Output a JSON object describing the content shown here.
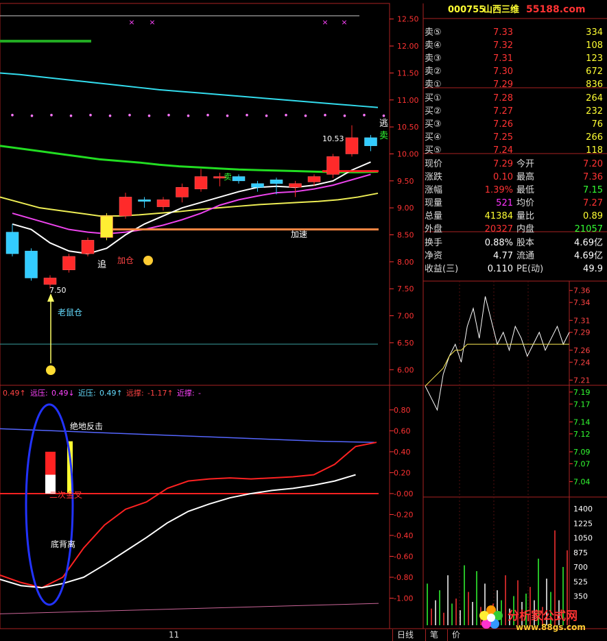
{
  "colors": {
    "up": "#ff2a2a",
    "down": "#33ccff",
    "grid": "#aa2222",
    "axis": "#ff3333",
    "bg": "#000000"
  },
  "header": {
    "code": "000755",
    "name": "山西三维",
    "watermark_top": "55188.com"
  },
  "quote": {
    "sell": [
      {
        "label": "卖⑤",
        "price": "7.33",
        "vol": "334"
      },
      {
        "label": "卖④",
        "price": "7.32",
        "vol": "108"
      },
      {
        "label": "卖③",
        "price": "7.31",
        "vol": "123"
      },
      {
        "label": "卖②",
        "price": "7.30",
        "vol": "672"
      },
      {
        "label": "卖①",
        "price": "7.29",
        "vol": "836"
      }
    ],
    "buy": [
      {
        "label": "买①",
        "price": "7.28",
        "vol": "264"
      },
      {
        "label": "买②",
        "price": "7.27",
        "vol": "232"
      },
      {
        "label": "买③",
        "price": "7.26",
        "vol": "76"
      },
      {
        "label": "买④",
        "price": "7.25",
        "vol": "266"
      },
      {
        "label": "买⑤",
        "price": "7.24",
        "vol": "118"
      }
    ],
    "stats": [
      {
        "l1": "现价",
        "v1": "7.29",
        "l2": "今开",
        "v2": "7.20"
      },
      {
        "l1": "涨跌",
        "v1": "0.10",
        "l2": "最高",
        "v2": "7.36"
      },
      {
        "l1": "涨幅",
        "v1": "1.39%",
        "l2": "最低",
        "v2": "7.15"
      },
      {
        "l1": "现量",
        "v1": "521",
        "l2": "均价",
        "v2": "7.27"
      },
      {
        "l1": "总量",
        "v1": "41384",
        "l2": "量比",
        "v2": "0.89"
      },
      {
        "l1": "外盘",
        "v1": "20327",
        "l2": "内盘",
        "v2": "21057"
      }
    ],
    "fund": [
      {
        "l1": "换手",
        "v1": "0.88%",
        "l2": "股本",
        "v2": "4.69亿"
      },
      {
        "l1": "净资",
        "v1": "4.77",
        "l2": "流通",
        "v2": "4.69亿"
      },
      {
        "l1": "收益(三)",
        "v1": "0.110",
        "l2": "PE(动)",
        "v2": "49.9"
      }
    ]
  },
  "indicator_header": {
    "v0": "0.49↑",
    "items": [
      {
        "label": "远压:",
        "value": "0.49↓"
      },
      {
        "label": "近压:",
        "value": "0.49↑"
      },
      {
        "label": "远撑:",
        "value": "-1.17↑"
      },
      {
        "label": "近撑:",
        "value": "-"
      }
    ]
  },
  "annotations": {
    "zhui": "追",
    "jiacang": "加仓",
    "jiasu": "加速",
    "laoshucang": "老鼠仓",
    "low": "7.50",
    "high": "10.53",
    "tao": "逃",
    "mai_sell": "卖",
    "mai_mid": "卖",
    "juedi": "绝地反击",
    "erci": "二次金叉",
    "dibeili": "底背离"
  },
  "bottom": {
    "date": "11",
    "tabs": [
      "日线",
      "笔",
      "价"
    ],
    "watermark_cn": "分析家公式网",
    "watermark_url": "www.88gs.com"
  },
  "chart_data": [
    {
      "type": "candlestick",
      "name": "main",
      "y_ticks": [
        "12.50",
        "12.00",
        "11.50",
        "11.00",
        "10.50",
        "10.00",
        "9.50",
        "9.00",
        "8.50",
        "8.00",
        "7.50",
        "7.00",
        "6.50",
        "6.00"
      ],
      "ylim": [
        5.8,
        12.7
      ],
      "candles": [
        {
          "o": 8.55,
          "c": 8.15,
          "h": 8.7,
          "l": 8.1
        },
        {
          "o": 8.2,
          "c": 7.7,
          "h": 8.25,
          "l": 7.65
        },
        {
          "o": 7.58,
          "c": 7.7,
          "h": 7.75,
          "l": 7.5
        },
        {
          "o": 7.85,
          "c": 8.1,
          "h": 8.15,
          "l": 7.8
        },
        {
          "o": 8.15,
          "c": 8.4,
          "h": 8.45,
          "l": 8.1
        },
        {
          "o": 8.45,
          "c": 8.85,
          "h": 8.9,
          "l": 8.4
        },
        {
          "o": 8.85,
          "c": 9.2,
          "h": 9.28,
          "l": 8.8
        },
        {
          "o": 9.15,
          "c": 9.12,
          "h": 9.2,
          "l": 9.0
        },
        {
          "o": 9.02,
          "c": 9.15,
          "h": 9.2,
          "l": 8.95
        },
        {
          "o": 9.2,
          "c": 9.38,
          "h": 9.45,
          "l": 9.1
        },
        {
          "o": 9.35,
          "c": 9.58,
          "h": 9.72,
          "l": 9.3
        },
        {
          "o": 9.55,
          "c": 9.58,
          "h": 9.65,
          "l": 9.4
        },
        {
          "o": 9.58,
          "c": 9.5,
          "h": 9.62,
          "l": 9.45
        },
        {
          "o": 9.45,
          "c": 9.38,
          "h": 9.5,
          "l": 9.3
        },
        {
          "o": 9.52,
          "c": 9.45,
          "h": 9.56,
          "l": 9.25
        },
        {
          "o": 9.38,
          "c": 9.45,
          "h": 9.5,
          "l": 9.2
        },
        {
          "o": 9.48,
          "c": 9.58,
          "h": 9.62,
          "l": 9.4
        },
        {
          "o": 9.62,
          "c": 9.95,
          "h": 10.0,
          "l": 9.55
        },
        {
          "o": 10.0,
          "c": 10.3,
          "h": 10.53,
          "l": 9.95
        },
        {
          "o": 10.3,
          "c": 10.15,
          "h": 10.35,
          "l": 10.05
        }
      ],
      "ma_white": [
        8.7,
        8.6,
        8.35,
        8.2,
        8.15,
        8.25,
        8.5,
        8.7,
        8.85,
        9.0,
        9.1,
        9.2,
        9.3,
        9.38,
        9.4,
        9.38,
        9.42,
        9.5,
        9.7,
        9.85
      ],
      "ma_magenta": [
        8.9,
        8.8,
        8.7,
        8.6,
        8.55,
        8.52,
        8.55,
        8.6,
        8.68,
        8.78,
        8.9,
        9.05,
        9.15,
        9.22,
        9.28,
        9.3,
        9.35,
        9.42,
        9.52,
        9.62
      ],
      "ma_yellow": [
        9.2,
        9.1,
        9.0,
        8.95,
        8.9,
        8.85,
        8.85,
        8.87,
        8.9,
        8.93,
        8.97,
        9.0,
        9.03,
        9.06,
        9.08,
        9.1,
        9.12,
        9.15,
        9.2,
        9.27
      ],
      "ma_green": [
        10.15,
        10.1,
        10.05,
        10.0,
        9.95,
        9.9,
        9.87,
        9.84,
        9.8,
        9.77,
        9.75,
        9.73,
        9.71,
        9.7,
        9.69,
        9.68,
        9.67,
        9.66,
        9.66,
        9.67
      ],
      "ma_cyan": [
        11.5,
        11.47,
        11.43,
        11.39,
        11.35,
        11.31,
        11.27,
        11.23,
        11.19,
        11.16,
        11.13,
        11.1,
        11.07,
        11.04,
        11.01,
        10.98,
        10.95,
        10.92,
        10.89,
        10.86
      ],
      "orange_level": 8.6
    },
    {
      "type": "line",
      "name": "indicator",
      "y_ticks": [
        "0.80",
        "0.60",
        "0.40",
        "0.20",
        "-0.00",
        "-0.20",
        "-0.40",
        "-0.60",
        "-0.80",
        "-1.00"
      ],
      "ylim": [
        -1.18,
        0.95
      ],
      "red_line": [
        -0.78,
        -0.85,
        -0.9,
        -0.8,
        -0.52,
        -0.3,
        -0.15,
        -0.08,
        0.05,
        0.12,
        0.14,
        0.15,
        0.14,
        0.15,
        0.16,
        0.18,
        0.28,
        0.45,
        0.49
      ],
      "white_line": [
        -0.82,
        -0.88,
        -0.9,
        -0.86,
        -0.8,
        -0.68,
        -0.55,
        -0.42,
        -0.28,
        -0.17,
        -0.1,
        -0.04,
        0.0,
        0.03,
        0.05,
        0.08,
        0.12,
        0.18
      ],
      "blue_line": [
        0.62,
        0.6,
        0.58,
        0.56,
        0.54,
        0.52,
        0.5,
        0.49
      ]
    },
    {
      "type": "line",
      "name": "intraday",
      "y_ticks": [
        "7.36",
        "7.34",
        "7.31",
        "7.29",
        "7.26",
        "7.24",
        "7.21",
        "7.19",
        "7.17",
        "7.14",
        "7.12",
        "7.09",
        "7.07",
        "7.04"
      ],
      "ylim": [
        7.02,
        7.37
      ],
      "price": [
        7.2,
        7.18,
        7.16,
        7.22,
        7.25,
        7.27,
        7.24,
        7.3,
        7.33,
        7.28,
        7.35,
        7.31,
        7.27,
        7.29,
        7.26,
        7.3,
        7.28,
        7.25,
        7.27,
        7.29,
        7.26,
        7.28,
        7.3,
        7.27,
        7.29
      ],
      "avg": [
        7.2,
        7.21,
        7.22,
        7.23,
        7.25,
        7.26,
        7.26,
        7.27,
        7.27,
        7.27,
        7.27,
        7.27,
        7.27,
        7.27,
        7.27,
        7.27,
        7.27,
        7.27,
        7.27,
        7.27,
        7.27,
        7.27,
        7.27,
        7.27,
        7.27
      ]
    },
    {
      "type": "bar",
      "name": "intraday-volume",
      "y_ticks": [
        "1400",
        "1225",
        "1050",
        "875",
        "700",
        "525",
        "350"
      ],
      "ylim": [
        0,
        1400
      ],
      "values": [
        500,
        200,
        300,
        420,
        150,
        600,
        260,
        320,
        180,
        720,
        400,
        280,
        650,
        220,
        500,
        180,
        260,
        420,
        300,
        600,
        200,
        350,
        540,
        280,
        380,
        460,
        300,
        800,
        220,
        560,
        400,
        1140,
        300,
        700,
        900
      ]
    }
  ]
}
